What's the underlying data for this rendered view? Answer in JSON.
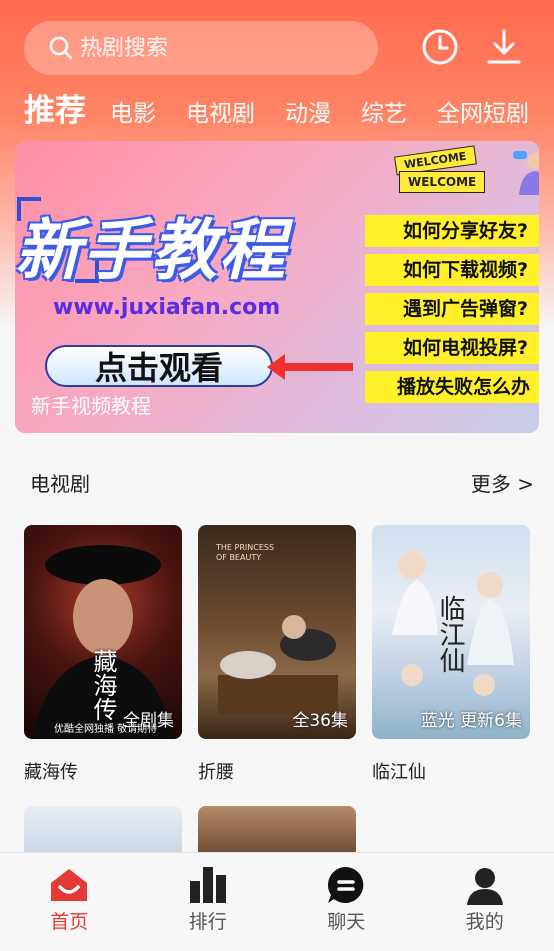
{
  "search": {
    "placeholder": "热剧搜索"
  },
  "header_icons": {
    "history": "clock-icon",
    "download": "download-icon"
  },
  "nav": {
    "tabs": [
      {
        "label": "推荐",
        "active": true
      },
      {
        "label": "电影"
      },
      {
        "label": "电视剧"
      },
      {
        "label": "动漫"
      },
      {
        "label": "综艺"
      },
      {
        "label": "全网短剧"
      }
    ]
  },
  "banner": {
    "title": "新手教程",
    "url": "www.juxiafan.com",
    "watch_button": "点击观看",
    "caption": "新手视频教程",
    "welcome_1": "WELCOME",
    "welcome_2": "WELCOME",
    "faq": [
      "如何分享好友?",
      "如何下载视频?",
      "遇到广告弹窗?",
      "如何电视投屏?",
      "播放失败怎么办"
    ]
  },
  "section": {
    "title": "电视剧",
    "more_label": "更多 >"
  },
  "cards": [
    {
      "name": "藏海传",
      "badge": "全剧集",
      "poster_text": "藏海传",
      "poster_footer": "优酷全网独播 敬请期待"
    },
    {
      "name": "折腰",
      "badge": "全36集",
      "poster_text": "THE PRINCESS OF BEAUTY"
    },
    {
      "name": "临江仙",
      "badge": "蓝光 更新6集",
      "poster_text": "临江仙"
    }
  ],
  "tabbar": {
    "items": [
      {
        "label": "首页",
        "icon": "home-icon",
        "active": true
      },
      {
        "label": "排行",
        "icon": "ranking-icon"
      },
      {
        "label": "聊天",
        "icon": "chat-icon"
      },
      {
        "label": "我的",
        "icon": "profile-icon"
      }
    ]
  },
  "colors": {
    "accent": "#e53935",
    "header": "#ff6a4e",
    "faq_bg": "#fff02a"
  }
}
